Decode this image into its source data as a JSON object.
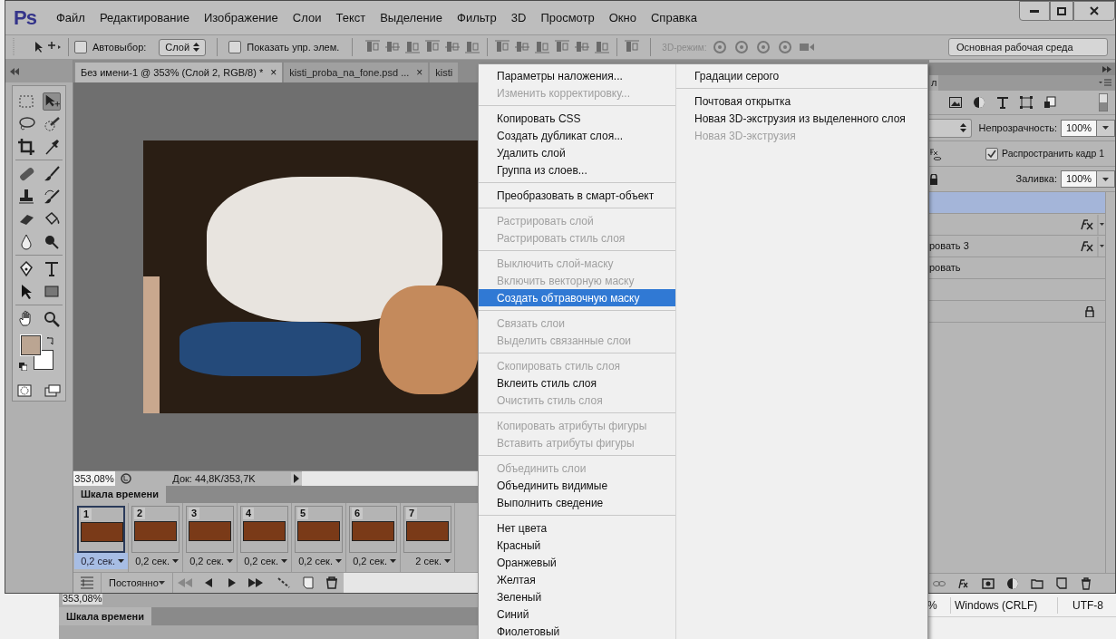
{
  "app": {
    "logo": "Ps",
    "menu": [
      "Файл",
      "Редактирование",
      "Изображение",
      "Слои",
      "Текст",
      "Выделение",
      "Фильтр",
      "3D",
      "Просмотр",
      "Окно",
      "Справка"
    ]
  },
  "options_bar": {
    "auto_select": {
      "label": "Автовыбор:",
      "checked": false
    },
    "auto_select_target": "Слой",
    "show_controls": {
      "label": "Показать упр. элем.",
      "checked": false
    },
    "mode_3d_label": "3D-режим:",
    "workspace": "Основная рабочая среда"
  },
  "tabs": [
    {
      "label": "Без имени-1 @ 353% (Слой 2, RGB/8) *",
      "close": "×",
      "selected": true
    },
    {
      "label": "kisti_proba_na_fone.psd ...",
      "close": "×",
      "selected": false
    },
    {
      "label": "kisti",
      "selected": false
    }
  ],
  "status_bar": {
    "zoom": "353,08%",
    "doc": "Док: 44,8K/353,7K"
  },
  "timeline": {
    "title": "Шкала времени",
    "frames": [
      {
        "number": "1",
        "delay": "0,2 сек.",
        "selected": true
      },
      {
        "number": "2",
        "delay": "0,2 сек.",
        "selected": false
      },
      {
        "number": "3",
        "delay": "0,2 сек.",
        "selected": false
      },
      {
        "number": "4",
        "delay": "0,2 сек.",
        "selected": false
      },
      {
        "number": "5",
        "delay": "0,2 сек.",
        "selected": false
      },
      {
        "number": "6",
        "delay": "0,2 сек.",
        "selected": false
      },
      {
        "number": "7",
        "delay": "2 сек.",
        "selected": false
      }
    ],
    "loop": "Постоянно"
  },
  "layers_panel": {
    "tab": "л",
    "opacity_label": "Непрозрачность:",
    "opacity": "100%",
    "propagate": {
      "label": "Распространить кадр 1",
      "checked": true
    },
    "fill_label": "Заливка:",
    "fill": "100%",
    "layers": [
      {
        "selected": true,
        "fx": false,
        "locked": false
      },
      {
        "selected": false,
        "fx": true,
        "locked": false
      },
      {
        "name": "ровать 3",
        "selected": false,
        "fx": true,
        "locked": false
      },
      {
        "name": "ровать",
        "selected": false,
        "fx": false,
        "locked": false
      },
      {
        "selected": false,
        "fx": false,
        "locked": false
      },
      {
        "selected": false,
        "fx": false,
        "locked": true
      }
    ]
  },
  "context_menu": {
    "left": [
      {
        "kind": "item",
        "label": "Параметры наложения...",
        "disabled": false,
        "selected": false
      },
      {
        "kind": "item",
        "label": "Изменить корректировку...",
        "disabled": true,
        "selected": false
      },
      {
        "kind": "separator"
      },
      {
        "kind": "item",
        "label": "Копировать CSS",
        "disabled": false,
        "selected": false
      },
      {
        "kind": "item",
        "label": "Создать дубликат слоя...",
        "disabled": false,
        "selected": false
      },
      {
        "kind": "item",
        "label": "Удалить слой",
        "disabled": false,
        "selected": false
      },
      {
        "kind": "item",
        "label": "Группа из слоев...",
        "disabled": false,
        "selected": false
      },
      {
        "kind": "separator"
      },
      {
        "kind": "item",
        "label": "Преобразовать в смарт-объект",
        "disabled": false,
        "selected": false
      },
      {
        "kind": "separator"
      },
      {
        "kind": "item",
        "label": "Растрировать слой",
        "disabled": true,
        "selected": false
      },
      {
        "kind": "item",
        "label": "Растрировать стиль слоя",
        "disabled": true,
        "selected": false
      },
      {
        "kind": "separator"
      },
      {
        "kind": "item",
        "label": "Выключить слой-маску",
        "disabled": true,
        "selected": false
      },
      {
        "kind": "item",
        "label": "Включить векторную маску",
        "disabled": true,
        "selected": false
      },
      {
        "kind": "item",
        "label": "Создать обтравочную маску",
        "disabled": false,
        "selected": true
      },
      {
        "kind": "separator"
      },
      {
        "kind": "item",
        "label": "Связать слои",
        "disabled": true,
        "selected": false
      },
      {
        "kind": "item",
        "label": "Выделить связанные слои",
        "disabled": true,
        "selected": false
      },
      {
        "kind": "separator"
      },
      {
        "kind": "item",
        "label": "Скопировать стиль слоя",
        "disabled": true,
        "selected": false
      },
      {
        "kind": "item",
        "label": "Вклеить стиль слоя",
        "disabled": false,
        "selected": false
      },
      {
        "kind": "item",
        "label": "Очистить стиль слоя",
        "disabled": true,
        "selected": false
      },
      {
        "kind": "separator"
      },
      {
        "kind": "item",
        "label": "Копировать атрибуты фигуры",
        "disabled": true,
        "selected": false
      },
      {
        "kind": "item",
        "label": "Вставить атрибуты фигуры",
        "disabled": true,
        "selected": false
      },
      {
        "kind": "separator"
      },
      {
        "kind": "item",
        "label": "Объединить слои",
        "disabled": true,
        "selected": false
      },
      {
        "kind": "item",
        "label": "Объединить видимые",
        "disabled": false,
        "selected": false
      },
      {
        "kind": "item",
        "label": "Выполнить сведение",
        "disabled": false,
        "selected": false
      },
      {
        "kind": "separator"
      },
      {
        "kind": "item",
        "label": "Нет цвета",
        "disabled": false,
        "selected": false
      },
      {
        "kind": "item",
        "label": "Красный",
        "disabled": false,
        "selected": false
      },
      {
        "kind": "item",
        "label": "Оранжевый",
        "disabled": false,
        "selected": false
      },
      {
        "kind": "item",
        "label": "Желтая",
        "disabled": false,
        "selected": false
      },
      {
        "kind": "item",
        "label": "Зеленый",
        "disabled": false,
        "selected": false
      },
      {
        "kind": "item",
        "label": "Синий",
        "disabled": false,
        "selected": false
      },
      {
        "kind": "item",
        "label": "Фиолетовый",
        "disabled": false,
        "selected": false
      }
    ],
    "right": [
      {
        "kind": "item",
        "label": "Градации серого",
        "disabled": false,
        "selected": false
      },
      {
        "kind": "separator"
      },
      {
        "kind": "item",
        "label": "Почтовая открытка",
        "disabled": false,
        "selected": false
      },
      {
        "kind": "item",
        "label": "Новая 3D-экструзия из выделенного слоя",
        "disabled": false,
        "selected": false
      },
      {
        "kind": "item",
        "label": "Новая 3D-экструзия",
        "disabled": true,
        "selected": false
      }
    ]
  },
  "background_window": {
    "zoom": "353,08%",
    "panel_tab": "Шкала времени",
    "percent_fragment": "%",
    "line_endings": "Windows (CRLF)",
    "encoding": "UTF-8"
  }
}
